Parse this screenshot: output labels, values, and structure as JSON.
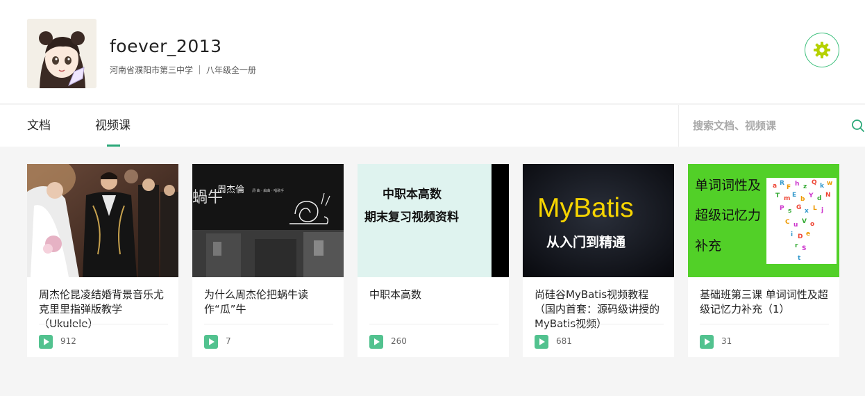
{
  "profile": {
    "username": "foever_2013",
    "school": "河南省濮阳市第三中学",
    "grade": "八年级全一册"
  },
  "tabs": [
    {
      "label": "文档",
      "active": false
    },
    {
      "label": "视频课",
      "active": true
    }
  ],
  "search": {
    "placeholder": "搜索文档、视频课"
  },
  "colors": {
    "accent": "#2aa878",
    "play_badge": "#52c28f"
  },
  "videos": [
    {
      "title": "周杰伦昆凌结婚背景音乐尤克里里指弹版教学（Ukulele）",
      "plays": "912",
      "thumb_text": []
    },
    {
      "title": "为什么周杰伦把蜗牛读作“瓜”牛",
      "plays": "7",
      "thumb_text": [
        "蝸牛",
        "周杰倫",
        "詞·曲 · 編曲 · 唱歌手"
      ]
    },
    {
      "title": "中职本高数",
      "plays": "260",
      "thumb_text": [
        "中职本高数",
        "期末复习视频资料"
      ]
    },
    {
      "title": "尚硅谷MyBatis视频教程（国内首套：源码级讲授的MyBatis视频）",
      "plays": "681",
      "thumb_text": [
        "MyBatis",
        "从入门到精通"
      ]
    },
    {
      "title": "基础班第三课 单词词性及超级记忆力补充（1）",
      "plays": "31",
      "thumb_text": [
        "单词词性及",
        "超级记忆力",
        "补充"
      ]
    }
  ]
}
